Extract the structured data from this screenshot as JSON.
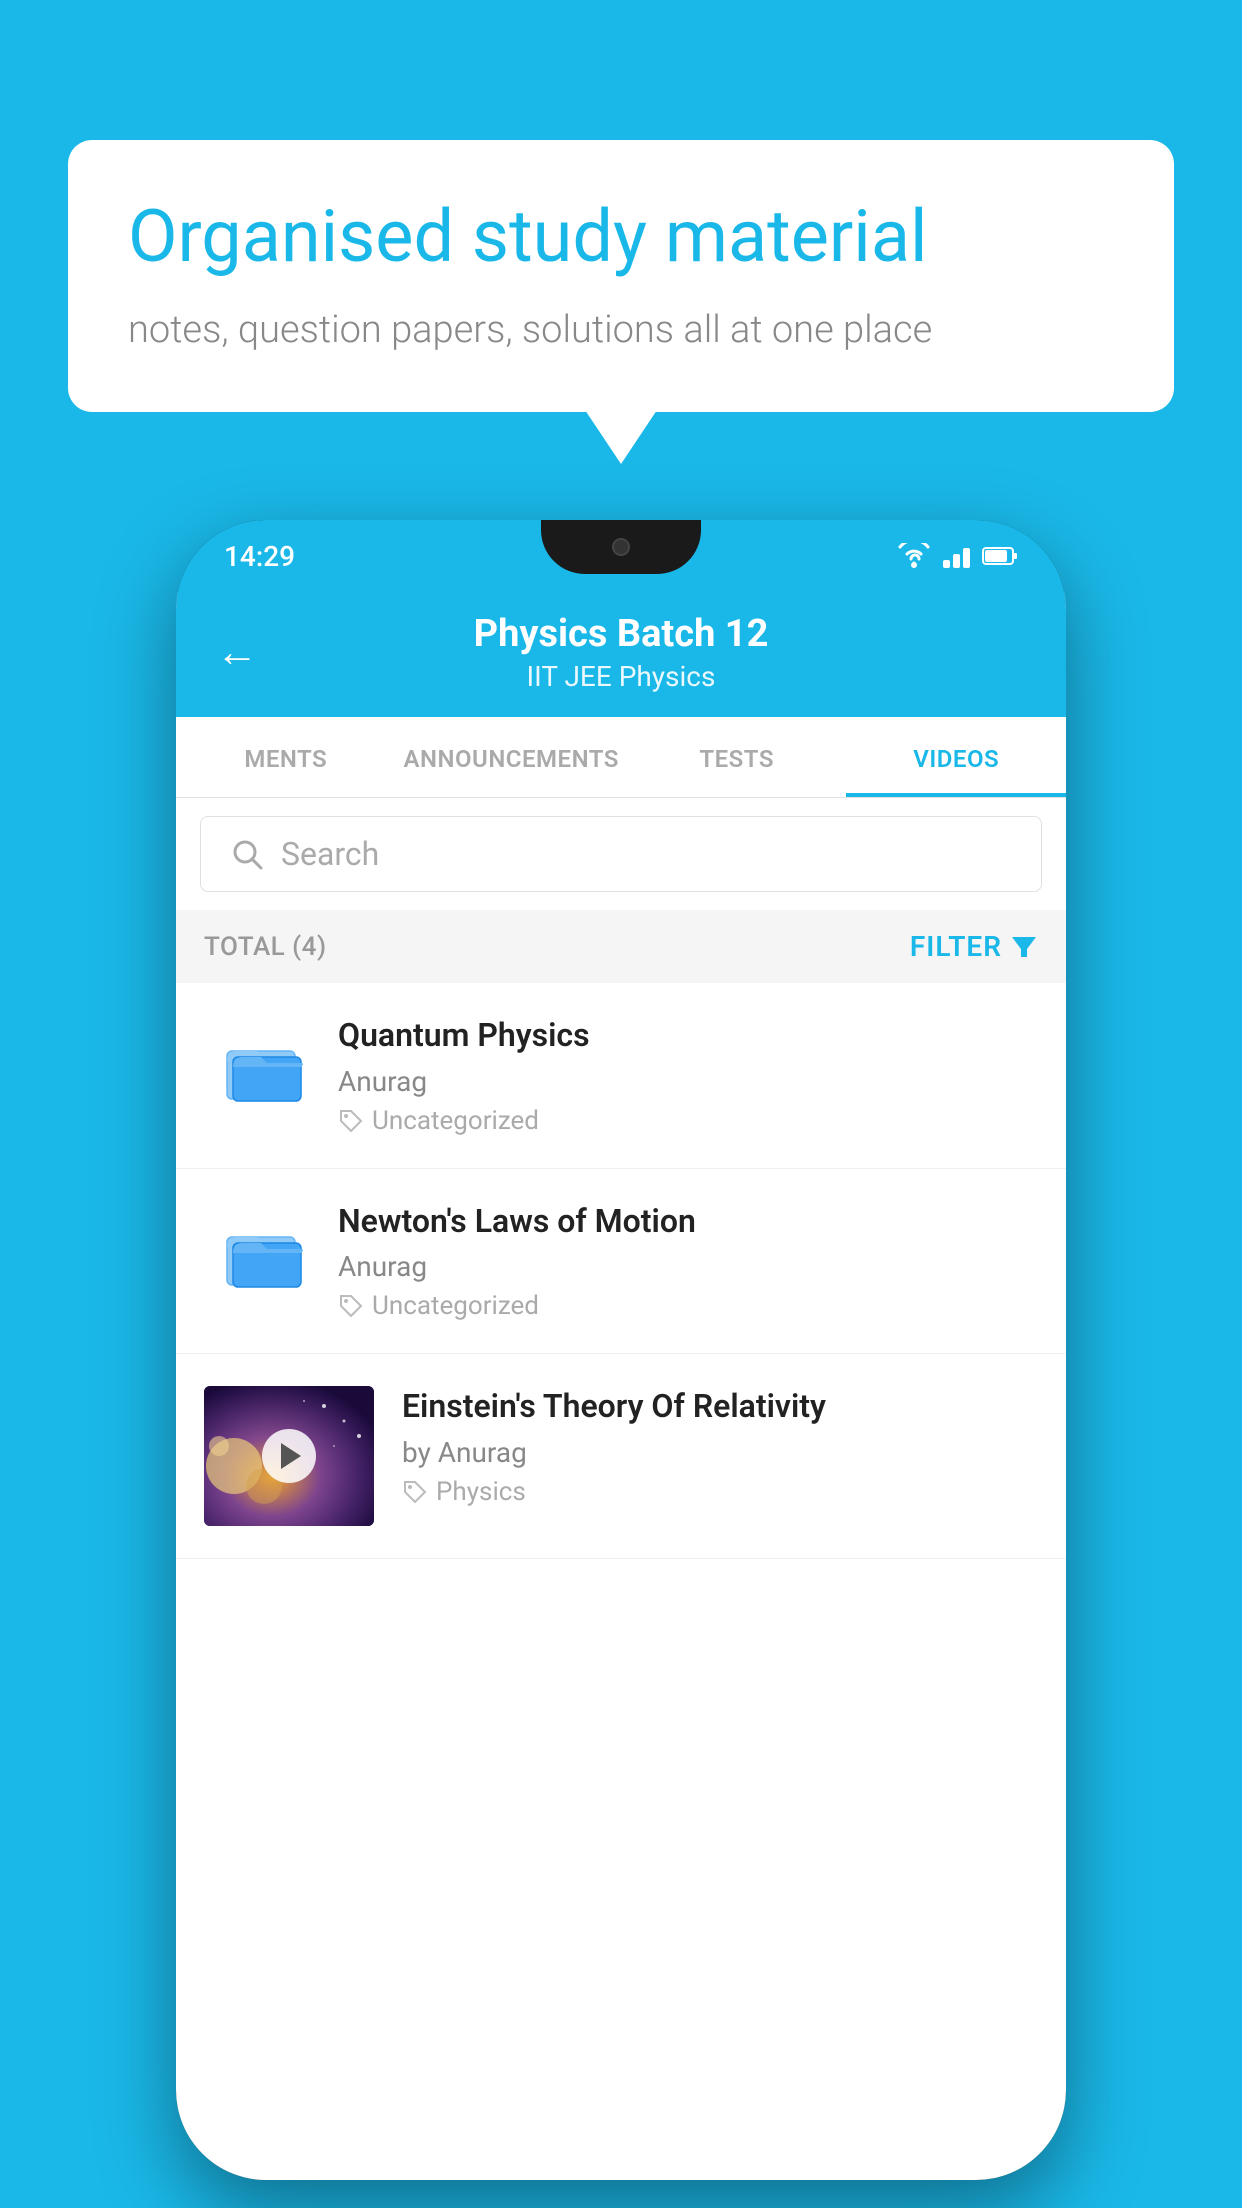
{
  "background_color": "#1ab8e8",
  "speech_bubble": {
    "title": "Organised study material",
    "subtitle": "notes, question papers, solutions all at one place"
  },
  "status_bar": {
    "time": "14:29",
    "wifi": "▼",
    "battery": "🔋"
  },
  "header": {
    "title": "Physics Batch 12",
    "subtitle_tags": "IIT JEE   Physics",
    "back_label": "←"
  },
  "tabs": [
    {
      "label": "MENTS",
      "active": false
    },
    {
      "label": "ANNOUNCEMENTS",
      "active": false
    },
    {
      "label": "TESTS",
      "active": false
    },
    {
      "label": "VIDEOS",
      "active": true
    }
  ],
  "search": {
    "placeholder": "Search"
  },
  "filter_row": {
    "total_label": "TOTAL (4)",
    "filter_label": "FILTER"
  },
  "videos": [
    {
      "id": 1,
      "title": "Quantum Physics",
      "author": "Anurag",
      "tag": "Uncategorized",
      "has_thumbnail": false
    },
    {
      "id": 2,
      "title": "Newton's Laws of Motion",
      "author": "Anurag",
      "tag": "Uncategorized",
      "has_thumbnail": false
    },
    {
      "id": 3,
      "title": "Einstein's Theory Of Relativity",
      "author": "by Anurag",
      "tag": "Physics",
      "has_thumbnail": true
    }
  ]
}
